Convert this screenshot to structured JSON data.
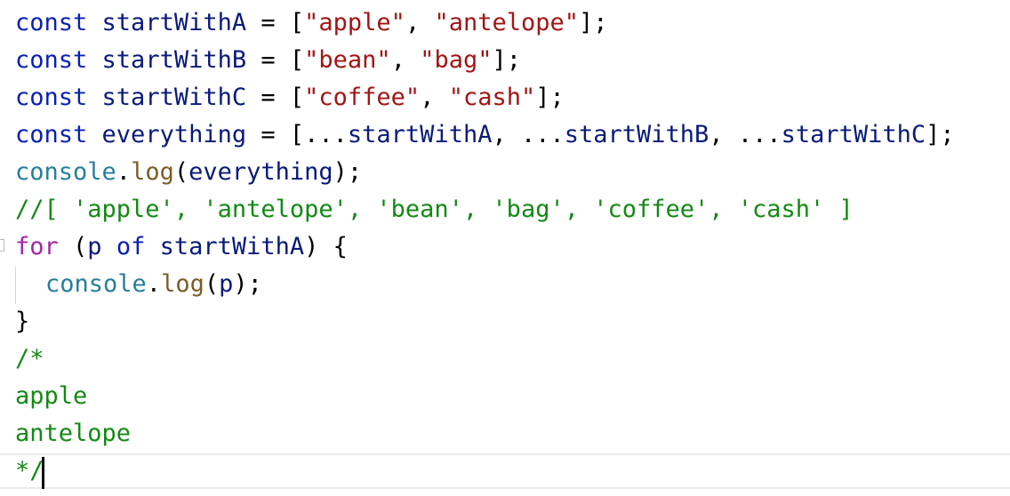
{
  "editor": {
    "lines": [
      {
        "tokens": [
          {
            "t": "const",
            "c": "kw"
          },
          {
            "t": " ",
            "c": "pun"
          },
          {
            "t": "startWithA",
            "c": "var"
          },
          {
            "t": " = [",
            "c": "pun"
          },
          {
            "t": "\"apple\"",
            "c": "str"
          },
          {
            "t": ", ",
            "c": "pun"
          },
          {
            "t": "\"antelope\"",
            "c": "str"
          },
          {
            "t": "];",
            "c": "pun"
          }
        ]
      },
      {
        "tokens": [
          {
            "t": "const",
            "c": "kw"
          },
          {
            "t": " ",
            "c": "pun"
          },
          {
            "t": "startWithB",
            "c": "var"
          },
          {
            "t": " = [",
            "c": "pun"
          },
          {
            "t": "\"bean\"",
            "c": "str"
          },
          {
            "t": ", ",
            "c": "pun"
          },
          {
            "t": "\"bag\"",
            "c": "str"
          },
          {
            "t": "];",
            "c": "pun"
          }
        ]
      },
      {
        "tokens": [
          {
            "t": "const",
            "c": "kw"
          },
          {
            "t": " ",
            "c": "pun"
          },
          {
            "t": "startWithC",
            "c": "var"
          },
          {
            "t": " = [",
            "c": "pun"
          },
          {
            "t": "\"coffee\"",
            "c": "str"
          },
          {
            "t": ", ",
            "c": "pun"
          },
          {
            "t": "\"cash\"",
            "c": "str"
          },
          {
            "t": "];",
            "c": "pun"
          }
        ]
      },
      {
        "tokens": [
          {
            "t": "const",
            "c": "kw"
          },
          {
            "t": " ",
            "c": "pun"
          },
          {
            "t": "everything",
            "c": "var"
          },
          {
            "t": " = [...",
            "c": "pun"
          },
          {
            "t": "startWithA",
            "c": "var"
          },
          {
            "t": ", ...",
            "c": "pun"
          },
          {
            "t": "startWithB",
            "c": "var"
          },
          {
            "t": ", ...",
            "c": "pun"
          },
          {
            "t": "startWithC",
            "c": "var"
          },
          {
            "t": "];",
            "c": "pun"
          }
        ]
      },
      {
        "tokens": [
          {
            "t": "console",
            "c": "obj"
          },
          {
            "t": ".",
            "c": "pun"
          },
          {
            "t": "log",
            "c": "fn"
          },
          {
            "t": "(",
            "c": "pun"
          },
          {
            "t": "everything",
            "c": "var"
          },
          {
            "t": ");",
            "c": "pun"
          }
        ]
      },
      {
        "tokens": [
          {
            "t": "//[ 'apple', 'antelope', 'bean', 'bag', 'coffee', 'cash' ]",
            "c": "cmt"
          }
        ]
      },
      {
        "tokens": [
          {
            "t": "for",
            "c": "kw2"
          },
          {
            "t": " (",
            "c": "pun"
          },
          {
            "t": "p",
            "c": "var"
          },
          {
            "t": " ",
            "c": "pun"
          },
          {
            "t": "of",
            "c": "kw"
          },
          {
            "t": " ",
            "c": "pun"
          },
          {
            "t": "startWithA",
            "c": "var"
          },
          {
            "t": ") {",
            "c": "pun"
          }
        ]
      },
      {
        "indent": true,
        "tokens": [
          {
            "t": "console",
            "c": "obj"
          },
          {
            "t": ".",
            "c": "pun"
          },
          {
            "t": "log",
            "c": "fn"
          },
          {
            "t": "(",
            "c": "pun"
          },
          {
            "t": "p",
            "c": "var"
          },
          {
            "t": ");",
            "c": "pun"
          }
        ]
      },
      {
        "tokens": [
          {
            "t": "}",
            "c": "pun"
          }
        ]
      },
      {
        "tokens": [
          {
            "t": "/*",
            "c": "cmt"
          }
        ]
      },
      {
        "tokens": [
          {
            "t": "apple",
            "c": "cmt"
          }
        ]
      },
      {
        "tokens": [
          {
            "t": "antelope",
            "c": "cmt"
          }
        ]
      },
      {
        "tokens": [
          {
            "t": "*/",
            "c": "cmt"
          }
        ]
      }
    ]
  }
}
